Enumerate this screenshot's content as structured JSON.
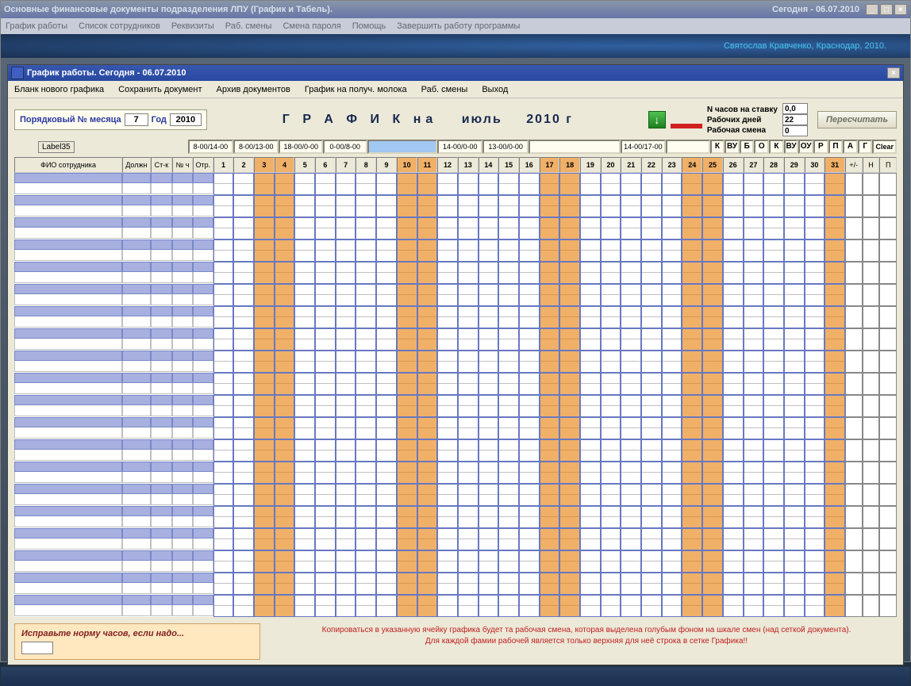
{
  "outer": {
    "title": "Основные финансовые документы подразделения ЛПУ (График и Табель).",
    "date": "Сегодня - 06.07.2010",
    "menu": [
      "График работы",
      "Список сотрудников",
      "Реквизиты",
      "Раб. смены",
      "Смена пароля",
      "Помощь",
      "Завершить работу программы"
    ],
    "credits": "Святослав Кравченко, Краснодар, 2010."
  },
  "inner": {
    "title": "График работы.   Сегодня - 06.07.2010",
    "menu": [
      "Бланк нового графика",
      "Сохранить документ",
      "Архив документов",
      "График на получ. молока",
      "Раб. смены",
      "Выход"
    ]
  },
  "params": {
    "month_label": "Порядковый № месяца",
    "month_value": "7",
    "year_label": "Год",
    "year_value": "2010",
    "chart_title": "Г Р А Ф И К на",
    "month_name": "июль",
    "year_text": "2010 г"
  },
  "stats": {
    "hours_label": "N часов на ставку",
    "hours_value": "0,0",
    "days_label": "Рабочих дней",
    "days_value": "22",
    "shift_label": "Рабочая смена",
    "shift_value": "0",
    "recalc": "Пересчитать"
  },
  "shifts": {
    "label35": "Label35",
    "items": [
      "8-00/14-00",
      "8-00/13-00",
      "18-00/0-00",
      "0-00/8-00",
      "",
      "14-00/0-00",
      "13-00/0-00",
      "",
      "14-00/17-00",
      ""
    ],
    "selected_index": 4,
    "codes": [
      "К",
      "ВУ",
      "Б",
      "О",
      "К",
      "ВУ",
      "ОУ",
      "Р",
      "П",
      "А",
      "Г"
    ],
    "clear": "Clear"
  },
  "grid": {
    "headers": {
      "fio": "ФИО сотрудника",
      "pos": "Должн",
      "rate": "Ст-к",
      "hours": "№ ч",
      "dep": "Отр."
    },
    "days": [
      1,
      2,
      3,
      4,
      5,
      6,
      7,
      8,
      9,
      10,
      11,
      12,
      13,
      14,
      15,
      16,
      17,
      18,
      19,
      20,
      21,
      22,
      23,
      24,
      25,
      26,
      27,
      28,
      29,
      30,
      31
    ],
    "weekends": [
      3,
      4,
      10,
      11,
      17,
      18,
      24,
      25,
      31
    ],
    "right_headers": [
      "+/-",
      "Н",
      "П"
    ],
    "row_count": 20
  },
  "footer": {
    "warn_title": "Исправьте норму часов, если надо...",
    "hint1": "Копироваться в указанную ячейку графика будет та рабочая смена, которая выделена голубым фоном на шкале смен (над сеткой документа).",
    "hint2": "Для каждой фамии рабочей является только верхняя для неё строка в сетке Графика!!"
  }
}
